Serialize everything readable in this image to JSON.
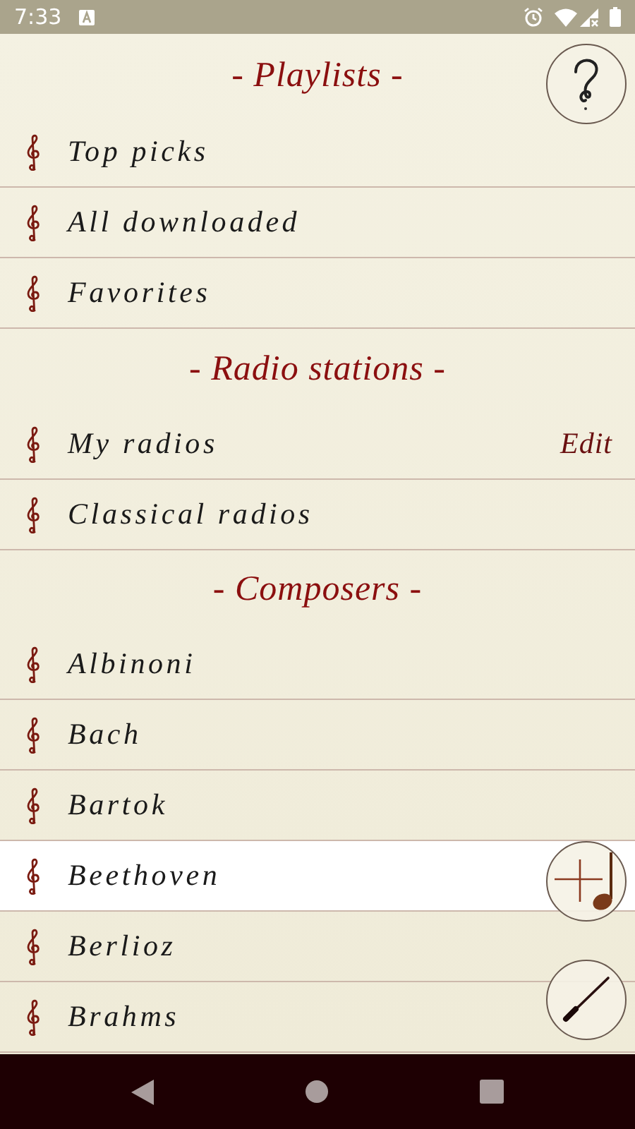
{
  "status_bar": {
    "time": "7:33"
  },
  "sections": [
    {
      "title": "- Playlists -",
      "items": [
        {
          "label": "Top picks",
          "selected": false
        },
        {
          "label": "All downloaded",
          "selected": false
        },
        {
          "label": "Favorites",
          "selected": false
        }
      ]
    },
    {
      "title": "- Radio stations -",
      "items": [
        {
          "label": "My radios",
          "selected": false,
          "action": "Edit"
        },
        {
          "label": "Classical radios",
          "selected": false
        }
      ]
    },
    {
      "title": "- Composers -",
      "items": [
        {
          "label": "Albinoni",
          "selected": false
        },
        {
          "label": "Bach",
          "selected": false
        },
        {
          "label": "Bartok",
          "selected": false
        },
        {
          "label": "Beethoven",
          "selected": true
        },
        {
          "label": "Berlioz",
          "selected": false
        },
        {
          "label": "Brahms",
          "selected": false
        }
      ]
    }
  ]
}
